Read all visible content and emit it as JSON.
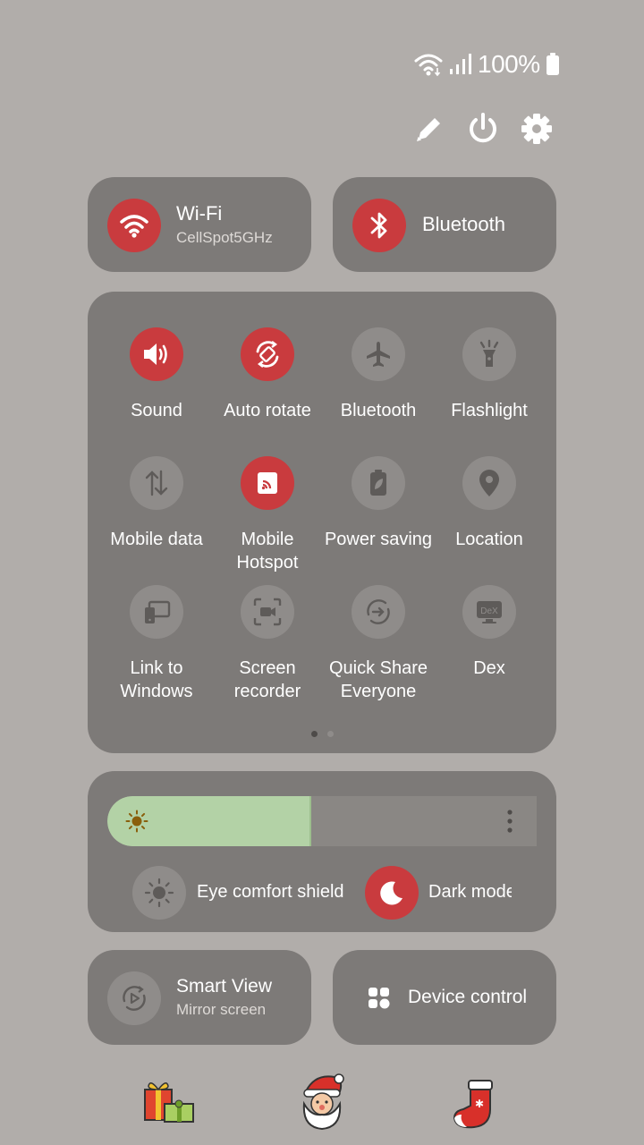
{
  "status_bar": {
    "battery_percent": "100%"
  },
  "header": {
    "edit_icon": "pencil-icon",
    "power_icon": "power-icon",
    "settings_icon": "gear-icon"
  },
  "top_toggles": {
    "wifi": {
      "title": "Wi-Fi",
      "subtitle": "CellSpot5GHz",
      "active": true
    },
    "bluetooth": {
      "title": "Bluetooth",
      "active": true
    }
  },
  "quick_tiles": [
    {
      "label": "Sound",
      "icon": "speaker-icon",
      "active": true
    },
    {
      "label": "Auto rotate",
      "icon": "rotate-icon",
      "active": true
    },
    {
      "label": "Bluetooth",
      "icon": "airplane-icon",
      "active": false
    },
    {
      "label": "Flashlight",
      "icon": "flashlight-icon",
      "active": false
    },
    {
      "label": "Mobile data",
      "icon": "data-arrows-icon",
      "active": false
    },
    {
      "label": "Mobile Hotspot",
      "icon": "hotspot-icon",
      "active": true
    },
    {
      "label": "Power saving",
      "icon": "battery-leaf-icon",
      "active": false
    },
    {
      "label": "Location",
      "icon": "location-pin-icon",
      "active": false
    },
    {
      "label": "Link to Windows",
      "icon": "link-windows-icon",
      "active": false
    },
    {
      "label": "Screen recorder",
      "icon": "screen-recorder-icon",
      "active": false
    },
    {
      "label": "Quick Share Everyone",
      "icon": "quick-share-icon",
      "active": false
    },
    {
      "label": "Dex",
      "icon": "dex-icon",
      "active": false
    }
  ],
  "pager": {
    "current_page": 1,
    "total_pages": 2
  },
  "brightness": {
    "level": 0.47
  },
  "display": {
    "eye_comfort_label": "Eye comfort shield",
    "dark_mode_label": "Dark mode",
    "dark_mode_active": true
  },
  "bottom": {
    "smart_view": {
      "title": "Smart View",
      "subtitle": "Mirror screen"
    },
    "device_control": {
      "title": "Device control"
    }
  },
  "stickers": [
    "gift-sticker",
    "santa-sticker",
    "stocking-sticker"
  ],
  "colors": {
    "accent": "#c93b3e",
    "card": "#7d7a78",
    "background": "#b1adaa",
    "brightness_fill": "#b3d2a6"
  }
}
